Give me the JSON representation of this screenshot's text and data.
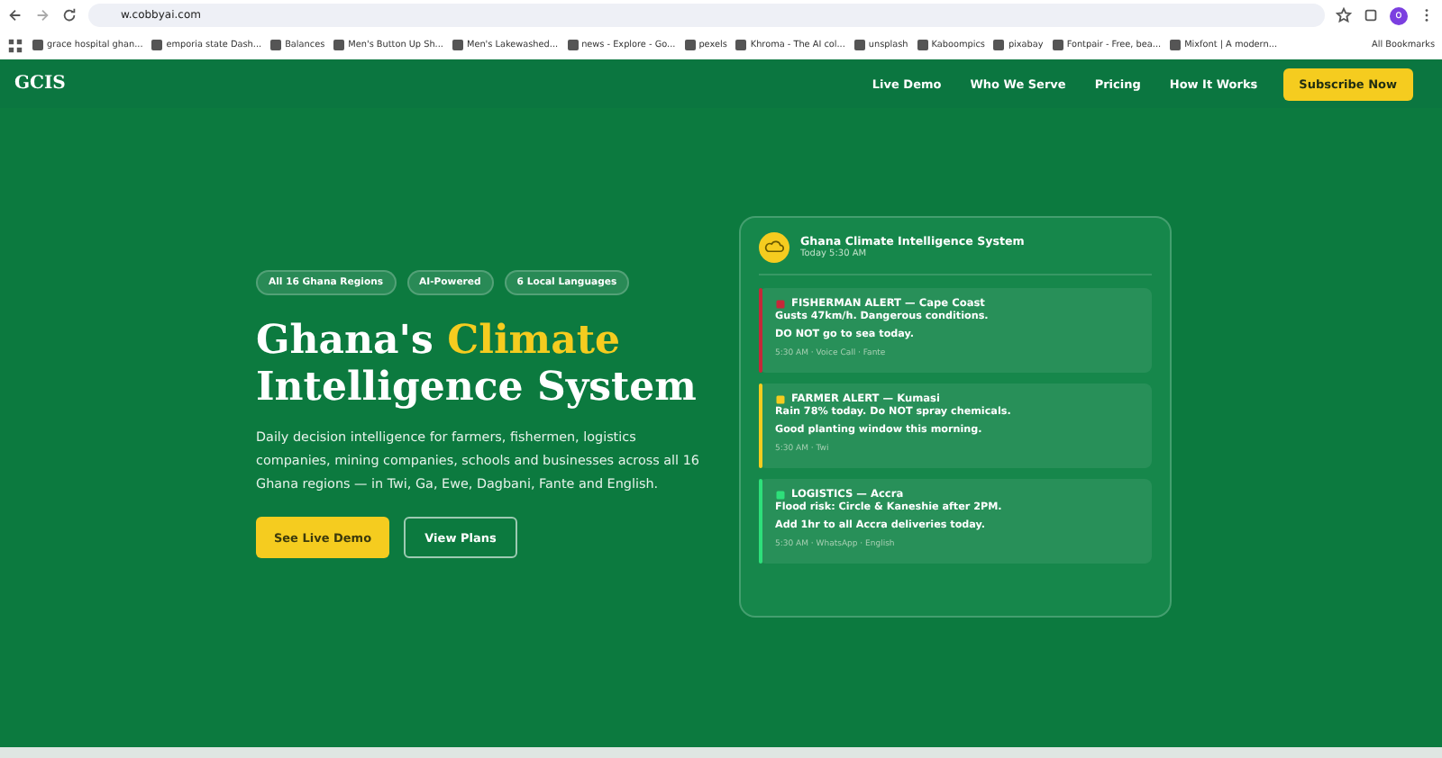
{
  "browser": {
    "url": "w.cobbyai.com",
    "bookmarks": [
      "grace hospital ghan...",
      "emporia state Dash...",
      "Balances",
      "Men's Button Up Sh...",
      "Men's Lakewashed...",
      "news - Explore - Go...",
      "pexels",
      "Khroma - The AI col...",
      "unsplash",
      "Kaboompics",
      "pixabay",
      "Fontpair - Free, bea...",
      "Mixfont | A modern..."
    ],
    "all_bookmarks": "All Bookmarks",
    "profile_initial": "o"
  },
  "nav": {
    "logo": "GCIS",
    "links": [
      "Live Demo",
      "Who We Serve",
      "Pricing",
      "How It Works"
    ],
    "cta": "Subscribe Now"
  },
  "hero": {
    "badges": [
      "All 16 Ghana Regions",
      "AI-Powered",
      "6 Local Languages"
    ],
    "title_start": "Ghana's",
    "title_highlight": "Climate",
    "title_end": "Intelligence System",
    "description": "Daily decision intelligence for farmers, fishermen, logistics companies, mining companies, schools and businesses across all 16 Ghana regions — in Twi, Ga, Ewe, Dagbani, Fante and English.",
    "buttons": [
      {
        "label": "See Live Demo",
        "kind": "primary"
      },
      {
        "label": "View Plans",
        "kind": "outline"
      }
    ]
  },
  "card": {
    "title": "Ghana Climate Intelligence System",
    "subtitle": "Today 5:30 AM",
    "alerts": [
      {
        "title": "FISHERMAN ALERT — Cape Coast",
        "lines": [
          "Gusts 47km/h. Dangerous conditions.",
          "DO NOT go to sea today."
        ],
        "meta": "5:30 AM · Voice Call · Fante",
        "color": "#c62839"
      },
      {
        "title": "FARMER ALERT — Kumasi",
        "lines": [
          "Rain 78% today. Do NOT spray chemicals.",
          "Good planting window this morning."
        ],
        "meta": "5:30 AM · Twi",
        "color": "#f5cc1f"
      },
      {
        "title": "LOGISTICS — Accra",
        "lines": [
          "Flood risk: Circle & Kaneshie after 2PM.",
          "Add 1hr to all Accra deliveries today."
        ],
        "meta": "5:30 AM · WhatsApp · English",
        "color": "#2ee07a"
      }
    ]
  }
}
